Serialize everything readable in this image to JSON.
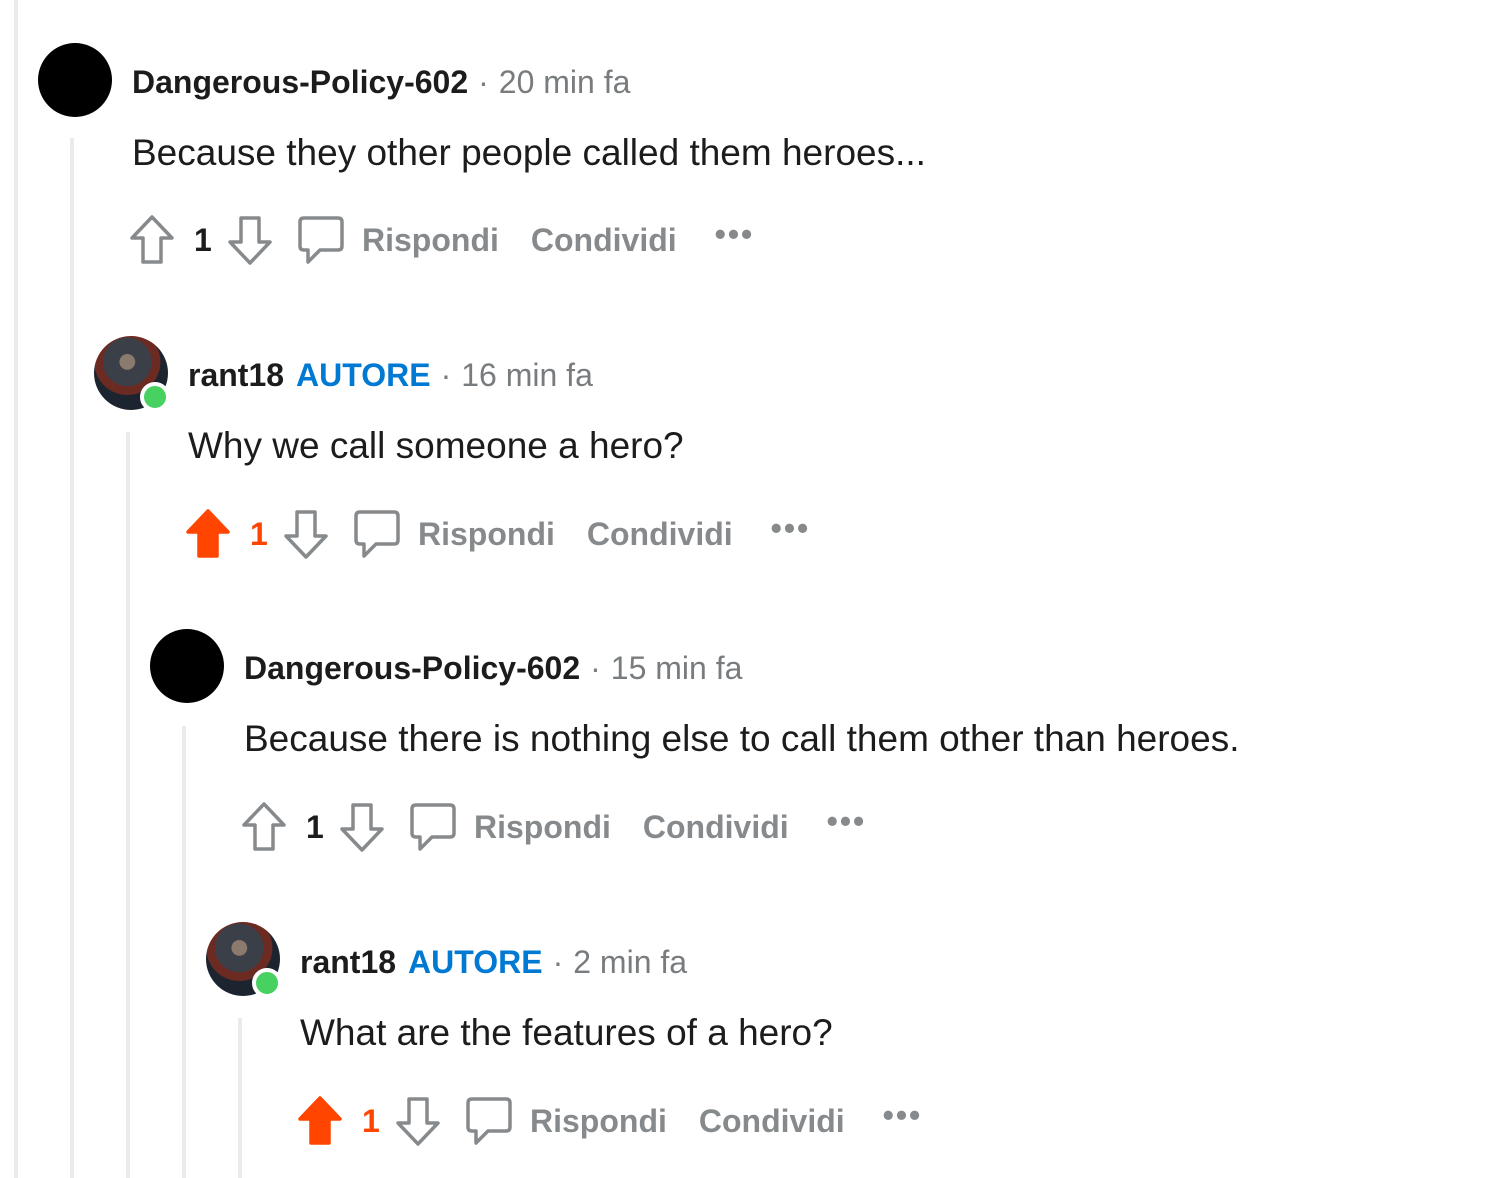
{
  "comments": [
    {
      "author": "Dangerous-Policy-602",
      "op_badge": "",
      "separator": "·",
      "time": "20 min fa",
      "text": "Because they other people called them heroes...",
      "score": "1",
      "upvoted": false,
      "reply_label": "Rispondi",
      "share_label": "Condividi",
      "more_label": "•••",
      "avatar": "black-avatar"
    },
    {
      "author": "rant18",
      "op_badge": "AUTORE",
      "separator": "·",
      "time": "16 min fa",
      "text": "Why we call someone a hero?",
      "score": "1",
      "upvoted": true,
      "reply_label": "Rispondi",
      "share_label": "Condividi",
      "more_label": "•••",
      "avatar": "photo-avatar-online"
    },
    {
      "author": "Dangerous-Policy-602",
      "op_badge": "",
      "separator": "·",
      "time": "15 min fa",
      "text": "Because there is nothing else to call them other than heroes.",
      "score": "1",
      "upvoted": false,
      "reply_label": "Rispondi",
      "share_label": "Condividi",
      "more_label": "•••",
      "avatar": "black-avatar"
    },
    {
      "author": "rant18",
      "op_badge": "AUTORE",
      "separator": "·",
      "time": "2 min fa",
      "text": "What are the features of a hero?",
      "score": "1",
      "upvoted": true,
      "reply_label": "Rispondi",
      "share_label": "Condividi",
      "more_label": "•••",
      "avatar": "photo-avatar-online"
    }
  ],
  "colors": {
    "upvote_active": "#ff4500",
    "op_badge": "#0079d3",
    "muted": "#878a8c",
    "online": "#46d160"
  }
}
